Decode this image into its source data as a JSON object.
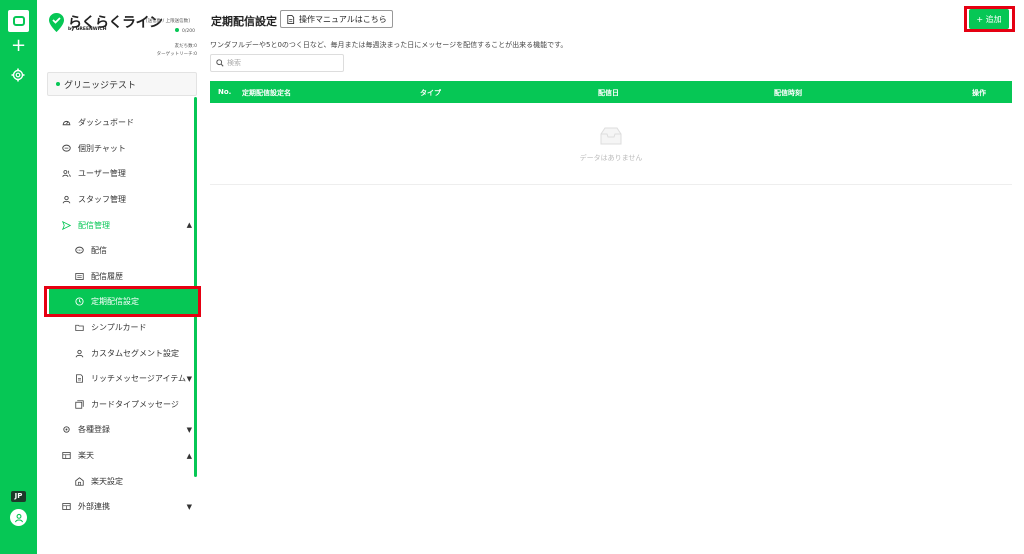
{
  "rail": {
    "jp_label": "JP",
    "logo_text": "GREENWICH"
  },
  "brand": {
    "name": "らくらくライン",
    "sub": "by GREENWICH"
  },
  "quota": {
    "label": "[送信数 / 上限送信数]",
    "value": "0/200"
  },
  "friends": {
    "friends_label": "友だち数:0",
    "reach_label": "ターゲットリーチ:0"
  },
  "account": {
    "name": "グリニッジテスト"
  },
  "nav": {
    "items": [
      {
        "label": "ダッシュボード",
        "icon": "dashboard-icon",
        "sub": false
      },
      {
        "label": "個別チャット",
        "icon": "chat-icon",
        "sub": false
      },
      {
        "label": "ユーザー管理",
        "icon": "users-icon",
        "sub": false
      },
      {
        "label": "スタッフ管理",
        "icon": "staff-icon",
        "sub": false
      },
      {
        "label": "配信管理",
        "icon": "send-icon",
        "sub": false
      },
      {
        "label": "配信",
        "icon": "message-icon",
        "sub": true
      },
      {
        "label": "配信履歴",
        "icon": "history-icon",
        "sub": true
      },
      {
        "label": "定期配信設定",
        "icon": "clock-icon",
        "sub": true
      },
      {
        "label": "シンプルカード",
        "icon": "folder-icon",
        "sub": true
      },
      {
        "label": "カスタムセグメント設定",
        "icon": "user-icon",
        "sub": true
      },
      {
        "label": "リッチメッセージアイテム",
        "icon": "document-icon",
        "sub": true
      },
      {
        "label": "カードタイプメッセージ",
        "icon": "cards-icon",
        "sub": true
      },
      {
        "label": "各種登録",
        "icon": "gear-icon",
        "sub": false
      },
      {
        "label": "楽天",
        "icon": "store-icon",
        "sub": false
      },
      {
        "label": "楽天設定",
        "icon": "store-settings-icon",
        "sub": true
      },
      {
        "label": "外部連携",
        "icon": "link-icon",
        "sub": false
      }
    ]
  },
  "main": {
    "title": "定期配信設定",
    "manual_label": "操作マニュアルはこちら",
    "description": "ワンダフルデーや5と0のつく日など、毎月または毎週決まった日にメッセージを配信することが出来る機能です。",
    "search_placeholder": "検索",
    "add_label": "+ 追加",
    "table": {
      "columns": [
        "No.",
        "定期配信設定名",
        "タイプ",
        "配信日",
        "配信時刻",
        "操作"
      ],
      "empty_text": "データはありません"
    }
  },
  "colors": {
    "brand_green": "#06c755",
    "highlight_red": "#e50012"
  }
}
